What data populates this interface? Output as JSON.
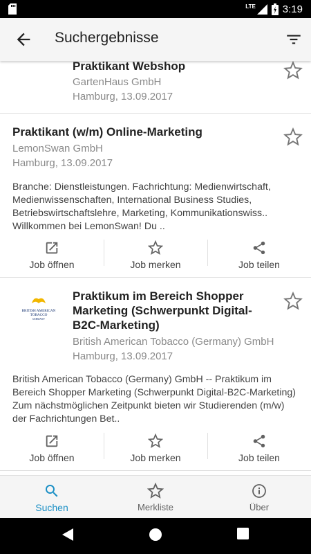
{
  "status": {
    "time": "3:19",
    "network": "LTE"
  },
  "appbar": {
    "title": "Suchergebnisse",
    "back_icon": "arrow-back-icon",
    "filter_icon": "filter-icon"
  },
  "results": [
    {
      "title": "Praktikant Webshop",
      "company": "GartenHaus GmbH",
      "meta": "Hamburg, 13.09.2017"
    },
    {
      "title": "Praktikant (w/m) Online-Marketing",
      "company": "LemonSwan GmbH",
      "meta": "Hamburg, 13.09.2017",
      "description": "Branche: Dienstleistungen. Fachrichtung: Medienwirtschaft, Medienwissenschaften, International Business Studies, Betriebswirtschaftslehre, Marketing, Kommunikationswiss.. Willkommen bei LemonSwan! Du ..",
      "actions": {
        "open": "Job öffnen",
        "save": "Job merken",
        "share": "Job teilen"
      }
    },
    {
      "title": "Praktikum im Bereich Shopper Marketing (Schwerpunkt Digital-B2C-Marketing)",
      "company": "British American Tobacco (Germany) GmbH",
      "meta": "Hamburg, 13.09.2017",
      "logo": {
        "line1": "BRITISH AMERICAN",
        "line2": "TOBACCO",
        "line3": "GERMANY"
      },
      "description": "British American Tobacco (Germany) GmbH -- Praktikum im Bereich Shopper Marketing (Schwerpunkt Digital-B2C-Marketing) Zum nächstmöglichen Zeitpunkt bieten wir Studierenden (m/w) der Fachrichtungen Bet..",
      "actions": {
        "open": "Job öffnen",
        "save": "Job merken",
        "share": "Job teilen"
      }
    }
  ],
  "bottom_nav": [
    {
      "label": "Suchen",
      "icon": "search-icon",
      "active": true
    },
    {
      "label": "Merkliste",
      "icon": "star-outline-icon",
      "active": false
    },
    {
      "label": "Über",
      "icon": "info-icon",
      "active": false
    }
  ],
  "colors": {
    "accent": "#1a8fc5",
    "appbar": "#f5f5f5",
    "text": "#212121",
    "muted": "#8a8a8a"
  }
}
